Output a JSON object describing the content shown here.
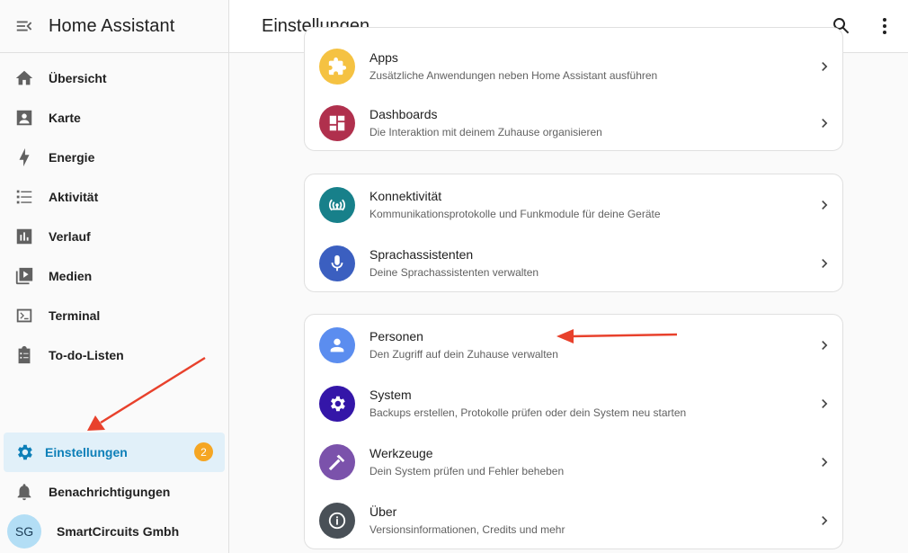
{
  "app": {
    "title": "Home Assistant"
  },
  "page": {
    "title": "Einstellungen"
  },
  "sidebar": {
    "items": [
      {
        "label": "Übersicht",
        "icon": "home-icon"
      },
      {
        "label": "Karte",
        "icon": "map-account-icon"
      },
      {
        "label": "Energie",
        "icon": "lightning-icon"
      },
      {
        "label": "Aktivität",
        "icon": "list-icon"
      },
      {
        "label": "Verlauf",
        "icon": "chart-box-icon"
      },
      {
        "label": "Medien",
        "icon": "media-icon"
      },
      {
        "label": "Terminal",
        "icon": "console-icon"
      },
      {
        "label": "To-do-Listen",
        "icon": "clipboard-list-icon"
      }
    ],
    "settings": {
      "label": "Einstellungen",
      "badge": "2",
      "icon": "cog-icon"
    },
    "notifications": {
      "label": "Benachrichtigungen",
      "icon": "bell-icon"
    },
    "user": {
      "initials": "SG",
      "name": "SmartCircuits Gmbh"
    }
  },
  "cards": [
    {
      "rows": [
        {
          "title": "Apps",
          "subtitle": "Zusätzliche Anwendungen neben Home Assistant ausführen",
          "color": "#f5c242",
          "icon": "puzzle-icon"
        },
        {
          "title": "Dashboards",
          "subtitle": "Die Interaktion mit deinem Zuhause organisieren",
          "color": "#b0304d",
          "icon": "dashboard-icon"
        }
      ]
    },
    {
      "rows": [
        {
          "title": "Konnektivität",
          "subtitle": "Kommunikationsprotokolle und Funkmodule für deine Geräte",
          "color": "#17808a",
          "icon": "antenna-icon"
        },
        {
          "title": "Sprachassistenten",
          "subtitle": "Deine Sprachassistenten verwalten",
          "color": "#3b5fc0",
          "icon": "microphone-icon"
        }
      ]
    },
    {
      "rows": [
        {
          "title": "Personen",
          "subtitle": "Den Zugriff auf dein Zuhause verwalten",
          "color": "#5b8def",
          "icon": "account-icon"
        },
        {
          "title": "System",
          "subtitle": "Backups erstellen, Protokolle prüfen oder dein System neu starten",
          "color": "#3416a8",
          "icon": "cog-icon"
        },
        {
          "title": "Werkzeuge",
          "subtitle": "Dein System prüfen und Fehler beheben",
          "color": "#7b52ab",
          "icon": "hammer-icon"
        },
        {
          "title": "Über",
          "subtitle": "Versionsinformationen, Credits und mehr",
          "color": "#495057",
          "icon": "info-icon"
        }
      ]
    }
  ],
  "colors": {
    "accent": "#0d7fb8",
    "annotation_arrow": "#e8412c",
    "badge": "#f5a623"
  }
}
